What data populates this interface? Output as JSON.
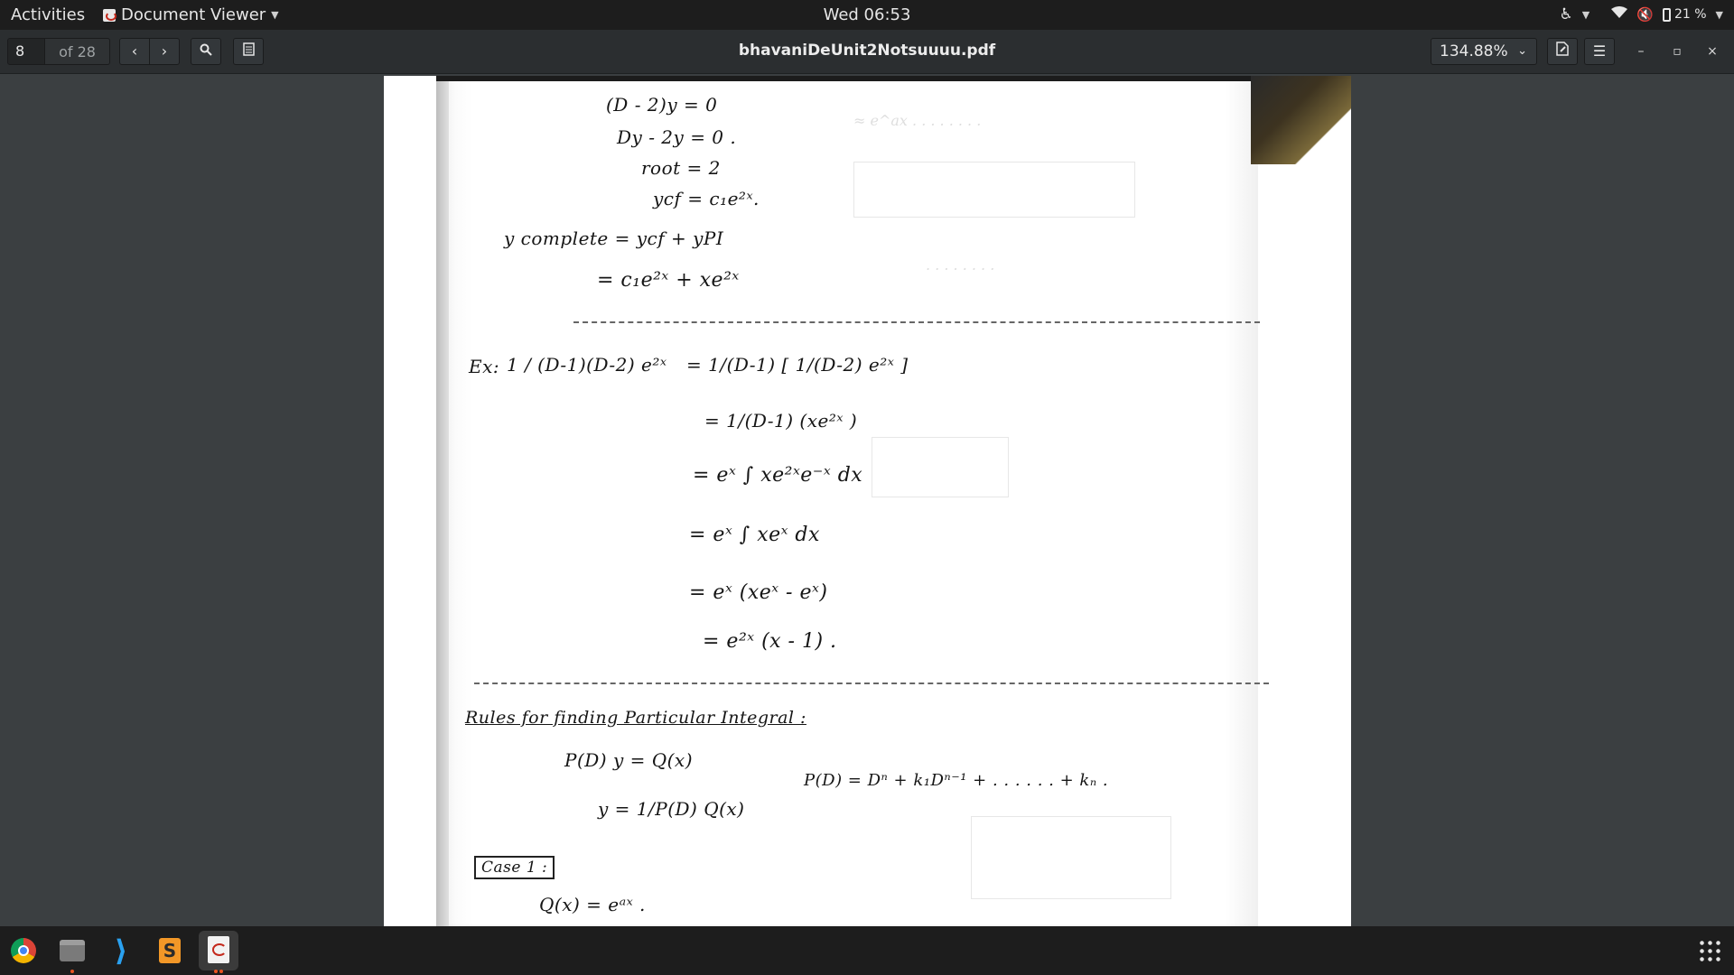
{
  "topbar": {
    "activities": "Activities",
    "app_name": "Document Viewer",
    "clock": "Wed 06:53",
    "battery": "21 %"
  },
  "headerbar": {
    "page_number": "8",
    "page_count": "of 28",
    "title": "bhavaniDeUnit2Notsuuuu.pdf",
    "zoom": "134.88%",
    "prev_icon": "chevron-left-icon",
    "next_icon": "chevron-right-icon",
    "search_icon": "search-icon",
    "sidebar_icon": "sidebar-icon"
  },
  "document": {
    "lines": [
      "(D - 2)y = 0",
      "Dy - 2y = 0 .",
      "root = 2",
      "ycf = c₁e²ˣ.",
      "y complete  =  ycf + yPI",
      "=  c₁e²ˣ + xe²ˣ",
      "Ex:",
      "1 / (D-1)(D-2)  e²ˣ",
      "=  1/(D-1) [ 1/(D-2) e²ˣ ]",
      "=  1/(D-1) (xe²ˣ )",
      "=  eˣ ∫ xe²ˣe⁻ˣ dx",
      "=  eˣ ∫ xeˣ dx",
      "=  eˣ (xeˣ - eˣ)",
      "=  e²ˣ (x - 1) .",
      "Rules for finding Particular Integral :",
      "P(D) y = Q(x)",
      "P(D) = Dⁿ + k₁Dⁿ⁻¹ + . . . . . . + kₙ .",
      "y = 1/P(D) Q(x)",
      "Case 1 :",
      "Q(x) = eᵃˣ ."
    ]
  },
  "dock": {
    "apps": [
      "chrome-icon",
      "files-icon",
      "vscode-icon",
      "sublime-text-icon",
      "document-viewer-icon"
    ]
  }
}
